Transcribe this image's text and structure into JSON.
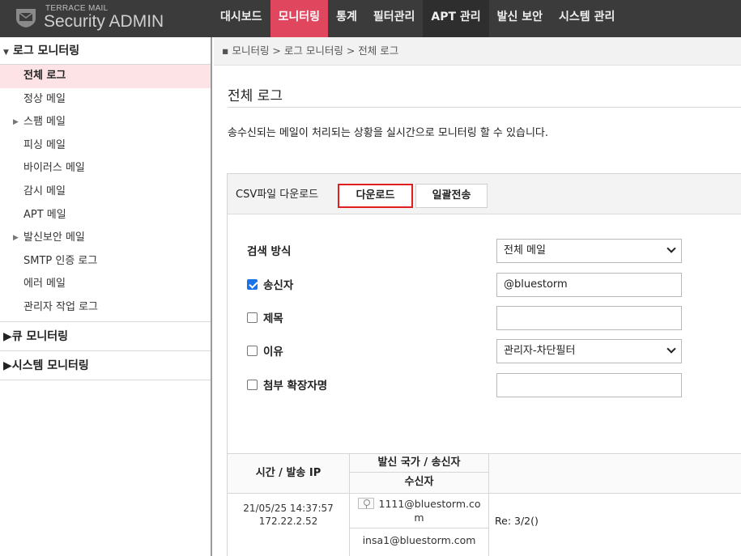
{
  "logo": {
    "small": "TERRACE MAIL",
    "big": "Security ADMIN"
  },
  "nav": [
    {
      "label": "대시보드",
      "state": ""
    },
    {
      "label": "모니터링",
      "state": "active"
    },
    {
      "label": "통계",
      "state": ""
    },
    {
      "label": "필터관리",
      "state": ""
    },
    {
      "label": "APT 관리",
      "state": "hl"
    },
    {
      "label": "발신 보안",
      "state": ""
    },
    {
      "label": "시스템 관리",
      "state": ""
    }
  ],
  "sidebar": {
    "log_section": "로그 모니터링",
    "items": [
      {
        "label": "전체 로그"
      },
      {
        "label": "정상 메일"
      },
      {
        "label": "스팸 메일"
      },
      {
        "label": "피싱 메일"
      },
      {
        "label": "바이러스 메일"
      },
      {
        "label": "감시 메일"
      },
      {
        "label": "APT 메일"
      },
      {
        "label": "발신보안 메일"
      },
      {
        "label": "SMTP 인증 로그"
      },
      {
        "label": "에러 메일"
      },
      {
        "label": "관리자 작업 로그"
      }
    ],
    "queue_section": "큐 모니터링",
    "system_section": "시스템 모니터링"
  },
  "breadcrumb": "▪ 모니터링 > 로그 모니터링 > 전체 로그",
  "page": {
    "title": "전체 로그",
    "description": "송수신되는 메일이 처리되는 상황을 실시간으로 모니터링 할 수 있습니다."
  },
  "panel": {
    "csv_label": "CSV파일 다운로드",
    "download_btn": "다운로드",
    "bulk_btn": "일괄전송"
  },
  "search": {
    "method_label": "검색 방식",
    "method_value": "전체 메일",
    "sender_label": "송신자",
    "sender_value": "@bluestorm",
    "subject_label": "제목",
    "subject_value": "",
    "reason_label": "이유",
    "reason_value": "관리자-차단필터",
    "ext_label": "첨부 확장자명",
    "ext_value": ""
  },
  "table": {
    "col_time": "시간 / 발송 IP",
    "col_sender": "발신 국가 / 송신자",
    "col_recipient": "수신자",
    "row": {
      "time": "21/05/25 14:37:57",
      "ip": "172.22.2.52",
      "sender_a": "1111@bluestorm.co",
      "sender_b": "m",
      "recipient": "insa1@bluestorm.com",
      "subject": "Re: 3/2()"
    }
  },
  "colors": {
    "topbar": "#3b3b3b",
    "accent": "#e0475f",
    "active_row": "#fde3e6",
    "download_border": "#e02020",
    "checkbox": "#1a73e8"
  }
}
